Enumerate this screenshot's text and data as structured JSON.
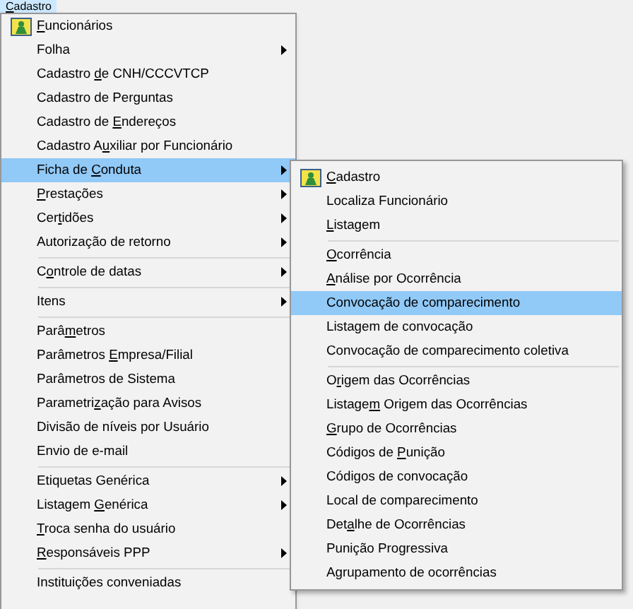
{
  "menubar": [
    {
      "key": "C",
      "post": "adastro",
      "selected": true
    }
  ],
  "menu": [
    {
      "kind": "item",
      "key": "F",
      "post": "uncionários",
      "icon": true,
      "submenu": false,
      "selected": false
    },
    {
      "kind": "item",
      "pre": "Folha",
      "submenu": true,
      "icon": false,
      "selected": false
    },
    {
      "kind": "item",
      "pre": "Cadastro ",
      "key": "d",
      "post": "e CNH/CCCVTCP",
      "submenu": false,
      "icon": false,
      "selected": false
    },
    {
      "kind": "item",
      "pre": "Cadastro de Perguntas",
      "submenu": false,
      "icon": false,
      "selected": false
    },
    {
      "kind": "item",
      "pre": "Cadastro de ",
      "key": "E",
      "post": "ndereços",
      "submenu": false,
      "icon": false,
      "selected": false
    },
    {
      "kind": "item",
      "pre": "Cadastro A",
      "key": "u",
      "post": "xiliar por Funcionário",
      "submenu": false,
      "icon": false,
      "selected": false
    },
    {
      "kind": "item",
      "pre": "Ficha de ",
      "key": "C",
      "post": "onduta",
      "submenu": true,
      "icon": false,
      "selected": true
    },
    {
      "kind": "item",
      "key": "P",
      "post": "restações",
      "submenu": true,
      "icon": false,
      "selected": false
    },
    {
      "kind": "item",
      "pre": "Cer",
      "key": "t",
      "post": "idões",
      "submenu": true,
      "icon": false,
      "selected": false
    },
    {
      "kind": "item",
      "pre": "Autorização de retorno",
      "submenu": true,
      "icon": false,
      "selected": false
    },
    {
      "kind": "separator"
    },
    {
      "kind": "item",
      "pre": "C",
      "key": "o",
      "post": "ntrole de datas",
      "submenu": true,
      "icon": false,
      "selected": false
    },
    {
      "kind": "separator"
    },
    {
      "kind": "item",
      "pre": "Itens",
      "submenu": true,
      "icon": false,
      "selected": false
    },
    {
      "kind": "separator"
    },
    {
      "kind": "item",
      "pre": "Parâ",
      "key": "m",
      "post": "etros",
      "submenu": false,
      "icon": false,
      "selected": false
    },
    {
      "kind": "item",
      "pre": "Parâmetros ",
      "key": "E",
      "post": "mpresa/Filial",
      "submenu": false,
      "icon": false,
      "selected": false
    },
    {
      "kind": "item",
      "pre": "Parâmetros de Sistema",
      "submenu": false,
      "icon": false,
      "selected": false
    },
    {
      "kind": "item",
      "pre": "Parametri",
      "key": "z",
      "post": "ação para Avisos",
      "submenu": false,
      "icon": false,
      "selected": false
    },
    {
      "kind": "item",
      "pre": "Divisão de níveis por Usuário",
      "submenu": false,
      "icon": false,
      "selected": false
    },
    {
      "kind": "item",
      "pre": "Envio de e-mail",
      "submenu": false,
      "icon": false,
      "selected": false
    },
    {
      "kind": "separator"
    },
    {
      "kind": "item",
      "pre": "Etiquetas Genérica",
      "submenu": true,
      "icon": false,
      "selected": false
    },
    {
      "kind": "item",
      "pre": "Listagem ",
      "key": "G",
      "post": "enérica",
      "submenu": true,
      "icon": false,
      "selected": false
    },
    {
      "kind": "item",
      "key": "T",
      "post": "roca senha do usuário",
      "submenu": false,
      "icon": false,
      "selected": false
    },
    {
      "kind": "item",
      "key": "R",
      "post": "esponsáveis PPP",
      "submenu": true,
      "icon": false,
      "selected": false
    },
    {
      "kind": "separator"
    },
    {
      "kind": "item",
      "pre": "Instituições conveniadas",
      "submenu": false,
      "icon": false,
      "selected": false
    }
  ],
  "submenu": [
    {
      "kind": "item",
      "key": "C",
      "post": "adastro",
      "icon": true,
      "selected": false
    },
    {
      "kind": "item",
      "pre": "Localiza Funcionário",
      "icon": false,
      "selected": false
    },
    {
      "kind": "item",
      "key": "L",
      "post": "istagem",
      "icon": false,
      "selected": false
    },
    {
      "kind": "separator"
    },
    {
      "kind": "item",
      "key": "O",
      "post": "corrência",
      "icon": false,
      "selected": false
    },
    {
      "kind": "item",
      "key": "A",
      "post": "nálise por Ocorrência",
      "icon": false,
      "selected": false
    },
    {
      "kind": "item",
      "pre": "Convocação de comparecimento",
      "icon": false,
      "selected": true
    },
    {
      "kind": "item",
      "pre": "Listagem de convocação",
      "icon": false,
      "selected": false
    },
    {
      "kind": "item",
      "pre": "Convocação de comparecimento coletiva",
      "icon": false,
      "selected": false
    },
    {
      "kind": "separator"
    },
    {
      "kind": "item",
      "pre": "O",
      "key": "r",
      "post": "igem das Ocorrências",
      "icon": false,
      "selected": false
    },
    {
      "kind": "item",
      "pre": "Listage",
      "key": "m",
      "post": " Origem das Ocorrências",
      "icon": false,
      "selected": false
    },
    {
      "kind": "item",
      "key": "G",
      "post": "rupo de Ocorrências",
      "icon": false,
      "selected": false
    },
    {
      "kind": "item",
      "pre": "Códigos de ",
      "key": "P",
      "post": "unição",
      "icon": false,
      "selected": false
    },
    {
      "kind": "item",
      "pre": "Códigos de convocação",
      "icon": false,
      "selected": false
    },
    {
      "kind": "item",
      "pre": "Local de comparecimento",
      "icon": false,
      "selected": false
    },
    {
      "kind": "item",
      "pre": "Det",
      "key": "a",
      "post": "lhe de Ocorrências",
      "icon": false,
      "selected": false
    },
    {
      "kind": "item",
      "pre": "Punição Progressiva",
      "icon": false,
      "selected": false
    },
    {
      "kind": "item",
      "pre": "Agrupamento de ocorrências",
      "icon": false,
      "selected": false
    }
  ]
}
